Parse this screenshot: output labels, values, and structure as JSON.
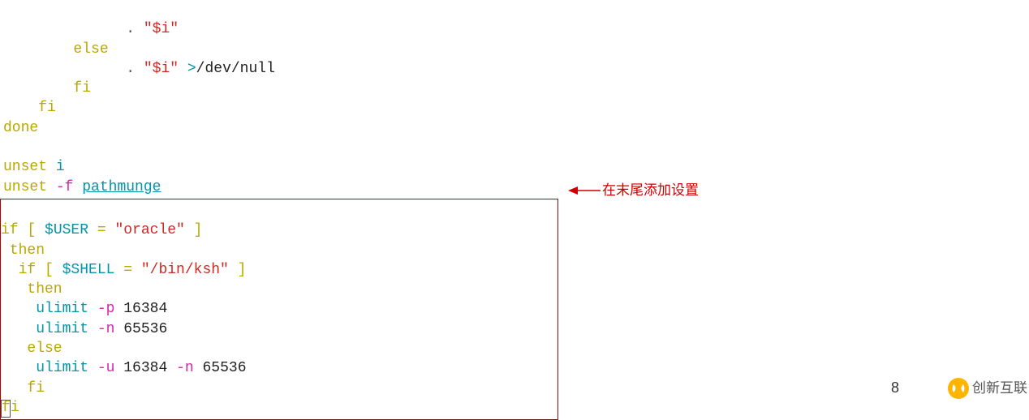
{
  "code": {
    "l1_dot": ". ",
    "l1_str": "\"$i\"",
    "l2_else": "else",
    "l3_dot": ". ",
    "l3_str": "\"$i\"",
    "l3_gt": " >",
    "l3_dev": "/dev/null",
    "l4_fi": "fi",
    "l5_fi": "fi",
    "l6_done": "done",
    "l8_unset": "unset",
    "l8_i": " i",
    "l9_unset": "unset",
    "l9_f": " -f ",
    "l9_func": "pathmunge"
  },
  "box": {
    "l1_if": "if",
    "l1_lb": " [ ",
    "l1_var": "$USER",
    "l1_eq": " = ",
    "l1_str": "\"oracle\"",
    "l1_rb": " ]",
    "l2_then": "then",
    "l3_if": "if",
    "l3_lb": " [ ",
    "l3_var": "$SHELL",
    "l3_eq": " = ",
    "l3_str": "\"/bin/ksh\"",
    "l3_rb": " ]",
    "l4_then": "then",
    "l5_ulimit": "ulimit",
    "l5_p": " -p ",
    "l5_num": "16384",
    "l6_ulimit": "ulimit",
    "l6_n": " -n ",
    "l6_num": "65536",
    "l7_else": "else",
    "l8_ulimit": "ulimit",
    "l8_u": " -u ",
    "l8_num1": "16384",
    "l8_n": " -n ",
    "l8_num2": "65536",
    "l9_fi": "fi",
    "l10_f": "f",
    "l10_i": "i"
  },
  "annotation": {
    "text": "在末尾添加设置"
  },
  "page_number": "8",
  "watermark": {
    "text": "创新互联"
  }
}
